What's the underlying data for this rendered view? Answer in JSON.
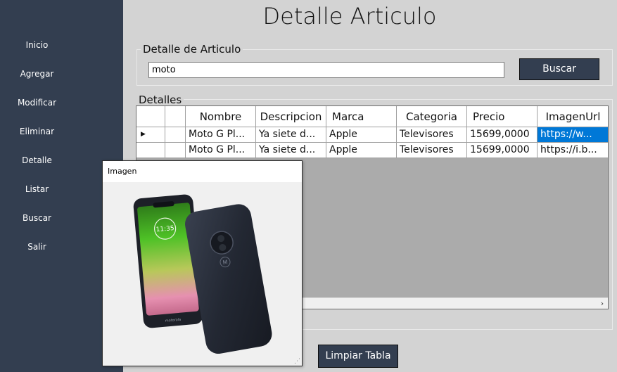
{
  "sidebar": {
    "items": [
      {
        "label": "Inicio"
      },
      {
        "label": "Agregar"
      },
      {
        "label": "Modificar"
      },
      {
        "label": "Eliminar"
      },
      {
        "label": "Detalle"
      },
      {
        "label": "Listar"
      },
      {
        "label": "Buscar"
      },
      {
        "label": "Salir"
      }
    ]
  },
  "page": {
    "title": "Detalle Articulo"
  },
  "search_group": {
    "label": "Detalle de Articulo",
    "input_value": "moto",
    "button_label": "Buscar"
  },
  "details_group": {
    "label": "Detalles"
  },
  "table": {
    "columns": [
      "Nombre",
      "Descripcion",
      "Marca",
      "Categoria",
      "Precio",
      "ImagenUrl"
    ],
    "current_row_marker": "▶",
    "rows": [
      [
        "Moto G Pl...",
        "Ya siete d...",
        "Apple",
        "Televisores",
        "15699,0000",
        "https://w..."
      ],
      [
        "Moto G Pl...",
        "Ya siete d...",
        "Apple",
        "Televisores",
        "15699,0000",
        "https://i.b..."
      ]
    ],
    "scroll_right_arrow": "›"
  },
  "clear_button": {
    "label": "Limpiar Tabla"
  },
  "image_popup": {
    "title": "Imagen",
    "image_label": "motorola"
  },
  "colors": {
    "sidebar_bg": "#333e50",
    "content_bg": "#d3d3d3",
    "selection": "#0078d7",
    "button_bg": "#333e50"
  }
}
